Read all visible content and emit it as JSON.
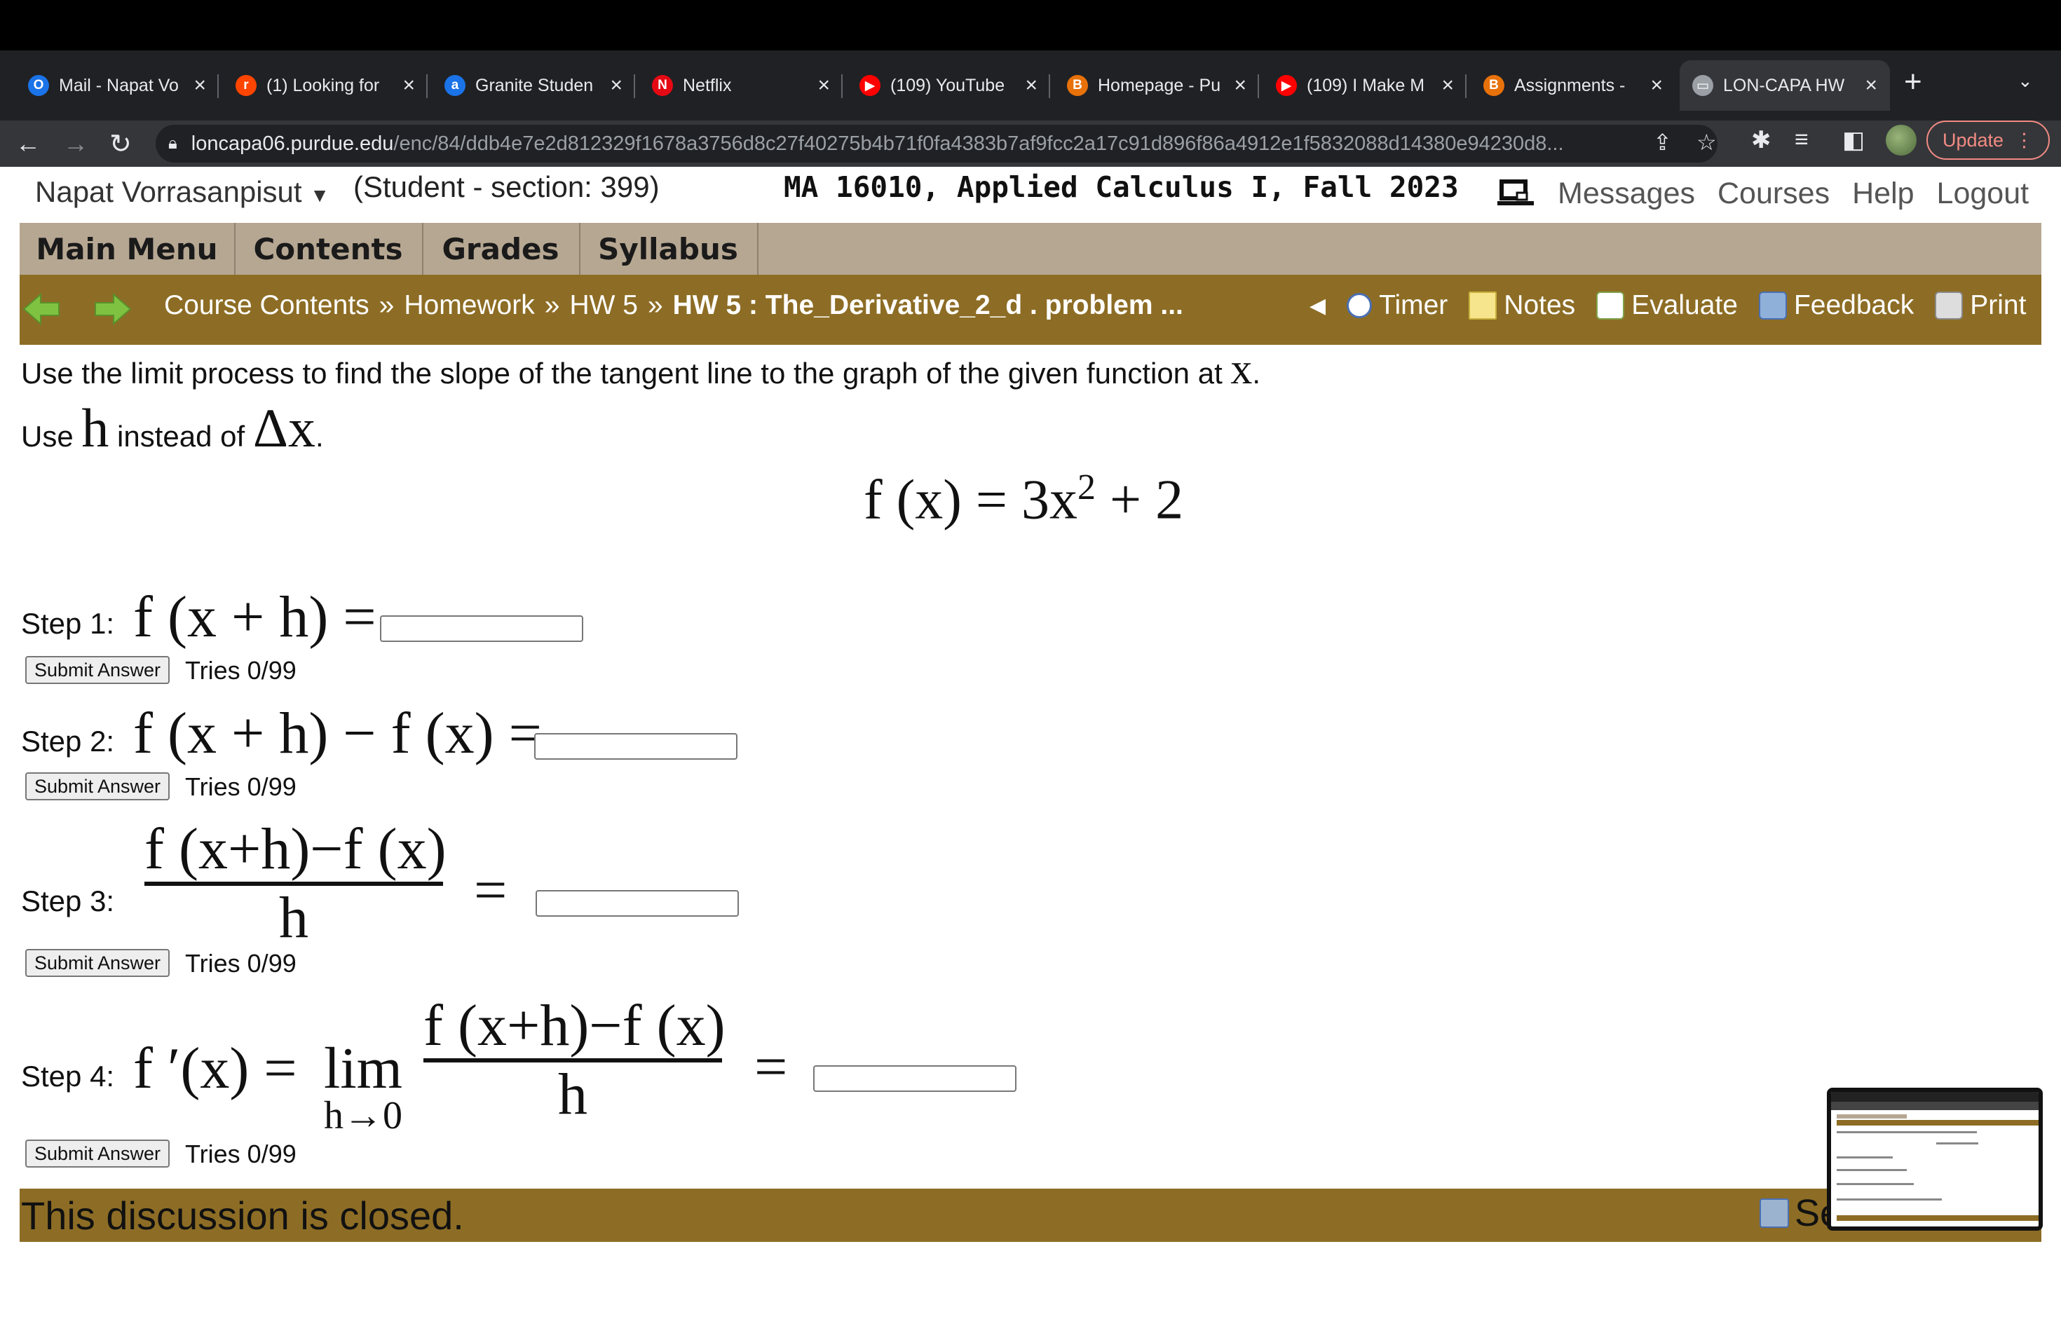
{
  "browser": {
    "tabs": [
      {
        "title": "Mail - Napat Vo",
        "icon": "outlook-icon",
        "color": "#1a73e8",
        "glyph": "O"
      },
      {
        "title": "(1) Looking for",
        "icon": "reddit-icon",
        "color": "#ff4500",
        "glyph": "r"
      },
      {
        "title": "Granite Studen",
        "icon": "granite-icon",
        "color": "#1a73e8",
        "glyph": "a"
      },
      {
        "title": "Netflix",
        "icon": "netflix-icon",
        "color": "#e50914",
        "glyph": "N"
      },
      {
        "title": "(109) YouTube",
        "icon": "youtube-icon",
        "color": "#ff0000",
        "glyph": "▶"
      },
      {
        "title": "Homepage - Pu",
        "icon": "brightspace-icon",
        "color": "#e8710a",
        "glyph": "B"
      },
      {
        "title": "(109) I Make M",
        "icon": "youtube-icon",
        "color": "#ff0000",
        "glyph": "▶"
      },
      {
        "title": "Assignments -",
        "icon": "brightspace-icon",
        "color": "#e8710a",
        "glyph": "B"
      },
      {
        "title": "LON-CAPA HW",
        "icon": "loncapa-icon",
        "color": "#9aa0a6",
        "glyph": "▭"
      }
    ],
    "url_host": "loncapa06.purdue.edu",
    "url_path": "/enc/84/ddb4e7e2d812329f1678a3756d8c27f40275b4b71f0fa4383b7af9fcc2a17c91d896f86a4912e1f5832088d14380e94230d8...",
    "update_label": "Update"
  },
  "header": {
    "user_name": "Napat Vorrasanpisut",
    "student_info": "(Student  - section: 399)",
    "course_title": "MA 16010, Applied Calculus I, Fall 2023",
    "links": {
      "messages": "Messages",
      "courses": "Courses",
      "help": "Help",
      "logout": "Logout"
    }
  },
  "main_menu": {
    "items": [
      "Main Menu",
      "Contents",
      "Grades",
      "Syllabus"
    ]
  },
  "navbar": {
    "breadcrumb": {
      "course_contents": "Course Contents",
      "homework": "Homework",
      "hw5": "HW 5",
      "current": "HW 5 : The_Derivative_2_d . problem ..."
    },
    "tools": {
      "timer": "Timer",
      "notes": "Notes",
      "evaluate": "Evaluate",
      "feedback": "Feedback",
      "print": "Print"
    }
  },
  "problem": {
    "instruction_text": "Use the limit process to find the slope of the tangent line to the graph of the given function at",
    "instruction_var": "x",
    "use_prefix": "Use",
    "use_var": "h",
    "use_mid": "instead of",
    "use_delta": "Δx",
    "function_lhs": "f (x) = 3x",
    "function_exp": "2",
    "function_rhs": " + 2",
    "steps": [
      {
        "label": "Step 1:",
        "expr": "f (x + h) =",
        "submit": "Submit Answer",
        "tries": "Tries 0/99"
      },
      {
        "label": "Step 2:",
        "expr": "f (x + h) − f (x) =",
        "submit": "Submit Answer",
        "tries": "Tries 0/99"
      },
      {
        "label": "Step 3:",
        "numerator": "f (x+h)−f (x)",
        "denominator": "h",
        "equals": "=",
        "submit": "Submit Answer",
        "tries": "Tries 0/99"
      },
      {
        "label": "Step 4:",
        "lhs": "f ′(x) =",
        "lim": "lim",
        "lim_sub": "h→0",
        "numerator": "f (x+h)−f (x)",
        "denominator": "h",
        "equals": "=",
        "submit": "Submit Answer",
        "tries": "Tries 0/99"
      }
    ]
  },
  "discussion": {
    "closed_text": "This discussion is closed.",
    "right_text": "Se"
  }
}
